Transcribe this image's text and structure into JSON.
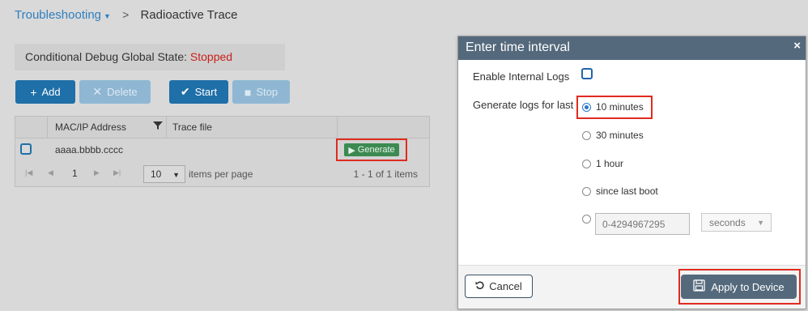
{
  "breadcrumb": {
    "parent": "Troubleshooting",
    "current": "Radioactive Trace"
  },
  "conditional": {
    "label": "Conditional Debug Global State:",
    "state": "Stopped"
  },
  "toolbar": {
    "add": "Add",
    "delete": "Delete",
    "start": "Start",
    "stop": "Stop"
  },
  "grid": {
    "columns": {
      "mac": "MAC/IP Address",
      "trace": "Trace file"
    },
    "rows": [
      {
        "mac": "aaaa.bbbb.cccc",
        "action": "Generate"
      }
    ],
    "pager": {
      "page": "1",
      "page_size": "10",
      "per_page_label": "items per page",
      "count": "1 - 1 of 1 items"
    }
  },
  "modal": {
    "title": "Enter time interval",
    "close": "×",
    "enable_logs_label": "Enable Internal Logs",
    "generate_label": "Generate logs for last",
    "options": {
      "o1": "10 minutes",
      "o2": "30 minutes",
      "o3": "1 hour",
      "o4": "since last boot"
    },
    "selected": "10 minutes",
    "custom_placeholder": "0-4294967295",
    "unit": "seconds",
    "cancel": "Cancel",
    "apply": "Apply to Device"
  },
  "icons": {
    "add": "plus-icon",
    "delete": "x-icon",
    "start": "check-icon",
    "stop": "stop-square-icon",
    "filter": "funnel-icon",
    "generate": "play-icon",
    "cancel": "undo-icon",
    "apply": "save-icon",
    "close": "close-icon",
    "pager_first": "first-page-icon",
    "pager_prev": "prev-page-icon",
    "pager_next": "next-page-icon",
    "pager_last": "last-page-icon"
  },
  "colors": {
    "primary": "#1f6fa8",
    "modal_header": "#54697c",
    "stopped": "#c9201a",
    "generate": "#3c8a52",
    "highlight": "#e02b20"
  }
}
